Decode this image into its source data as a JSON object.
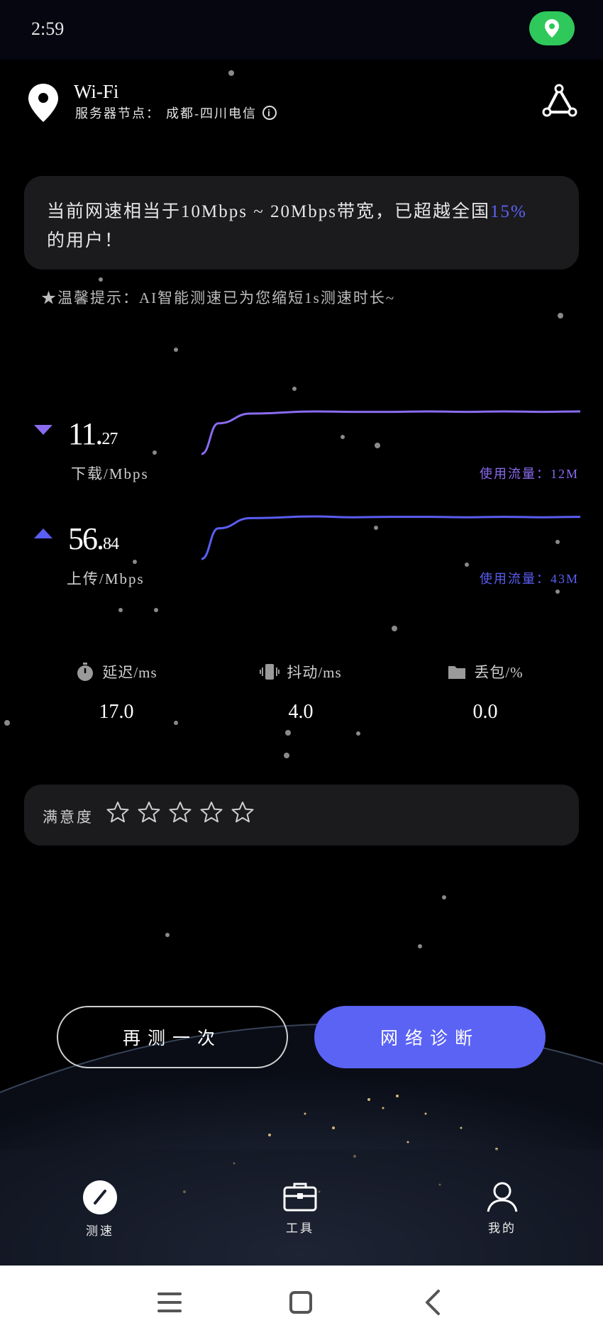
{
  "status_bar": {
    "time": "2:59",
    "location_indicator": "location-pin-icon"
  },
  "header": {
    "network_name": "Wi-Fi",
    "node_label": "服务器节点：",
    "node_value": "成都-四川电信"
  },
  "result": {
    "prefix": "当前网速相当于",
    "bandwidth": "10Mbps ~ 20Mbps",
    "mid": "带宽，已超越全国",
    "percent": "15%",
    "suffix": "的用户！"
  },
  "tip": "★温馨提示：AI智能测速已为您缩短1s测速时长~",
  "download": {
    "value_int": "11.",
    "value_dec": "27",
    "unit_label": "下载/Mbps",
    "usage": "使用流量：12M",
    "color": "#8a6bf0",
    "curve": [
      0.0,
      0.72,
      0.95,
      1.0,
      0.99,
      0.99,
      1.0,
      0.99,
      1.0,
      0.99,
      1.0
    ]
  },
  "upload": {
    "value_int": "56.",
    "value_dec": "84",
    "unit_label": "上传/Mbps",
    "usage": "使用流量：43M",
    "color": "#5a5ef2",
    "curve": [
      0.0,
      0.72,
      0.96,
      1.0,
      0.98,
      0.99,
      0.99,
      0.98,
      0.99,
      0.98,
      0.99
    ]
  },
  "stats": [
    {
      "icon": "stopwatch-icon",
      "label": "延迟/ms",
      "value": "17.0"
    },
    {
      "icon": "vibration-icon",
      "label": "抖动/ms",
      "value": "4.0"
    },
    {
      "icon": "folder-icon",
      "label": "丢包/%",
      "value": "0.0"
    }
  ],
  "rating": {
    "label": "满意度",
    "stars": 5,
    "filled": 0
  },
  "buttons": {
    "retest": "再测一次",
    "diagnose": "网络诊断"
  },
  "tabs": [
    {
      "icon": "speedometer-icon",
      "label": "测速"
    },
    {
      "icon": "toolbox-icon",
      "label": "工具"
    },
    {
      "icon": "user-icon",
      "label": "我的"
    }
  ],
  "system_nav": [
    "menu-icon",
    "home-icon",
    "back-icon"
  ]
}
